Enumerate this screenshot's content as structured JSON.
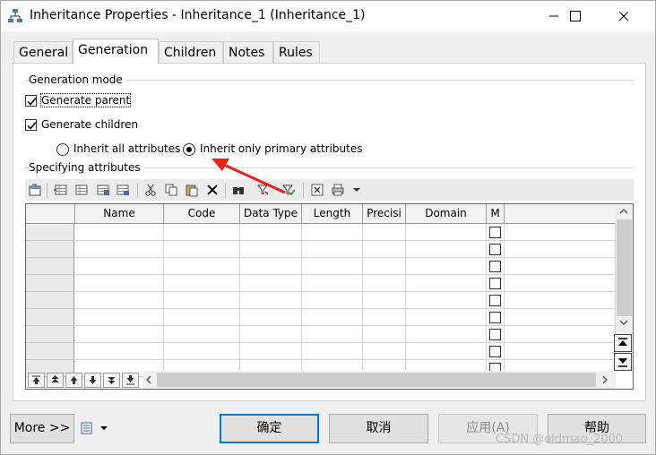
{
  "window": {
    "title": "Inheritance Properties - Inheritance_1 (Inheritance_1)"
  },
  "tabs": [
    {
      "label": "General",
      "active": false
    },
    {
      "label": "Generation",
      "active": true
    },
    {
      "label": "Children",
      "active": false
    },
    {
      "label": "Notes",
      "active": false
    },
    {
      "label": "Rules",
      "active": false
    }
  ],
  "generation": {
    "mode_label": "Generation mode",
    "generate_parent": {
      "label": "Generate parent",
      "checked": true
    },
    "generate_children": {
      "label": "Generate children",
      "checked": true
    },
    "inherit_all": {
      "label": "Inherit all attributes",
      "selected": false
    },
    "inherit_primary": {
      "label": "Inherit only primary attributes",
      "selected": true
    }
  },
  "attributes": {
    "section_label": "Specifying attributes",
    "columns": [
      "Name",
      "Code",
      "Data Type",
      "Length",
      "Precisi",
      "Domain",
      "M"
    ],
    "row_count": 9
  },
  "toolbar_icons": [
    "properties-icon",
    "add-row-icon",
    "insert-row-icon",
    "add-attributes-icon",
    "reuse-attributes-icon",
    "cut-icon",
    "copy-icon",
    "paste-icon",
    "delete-icon",
    "find-icon",
    "filter-icon",
    "filter-check-icon",
    "export-excel-icon",
    "print-icon",
    "dropdown-icon"
  ],
  "buttons": {
    "more": "More >>",
    "ok": "确定",
    "cancel": "取消",
    "apply": "应用(A)",
    "help": "帮助"
  },
  "watermark": "CSDN @oldmao_2000",
  "colors": {
    "accent": "#0078d7",
    "annotation_arrow": "#e8231b"
  }
}
